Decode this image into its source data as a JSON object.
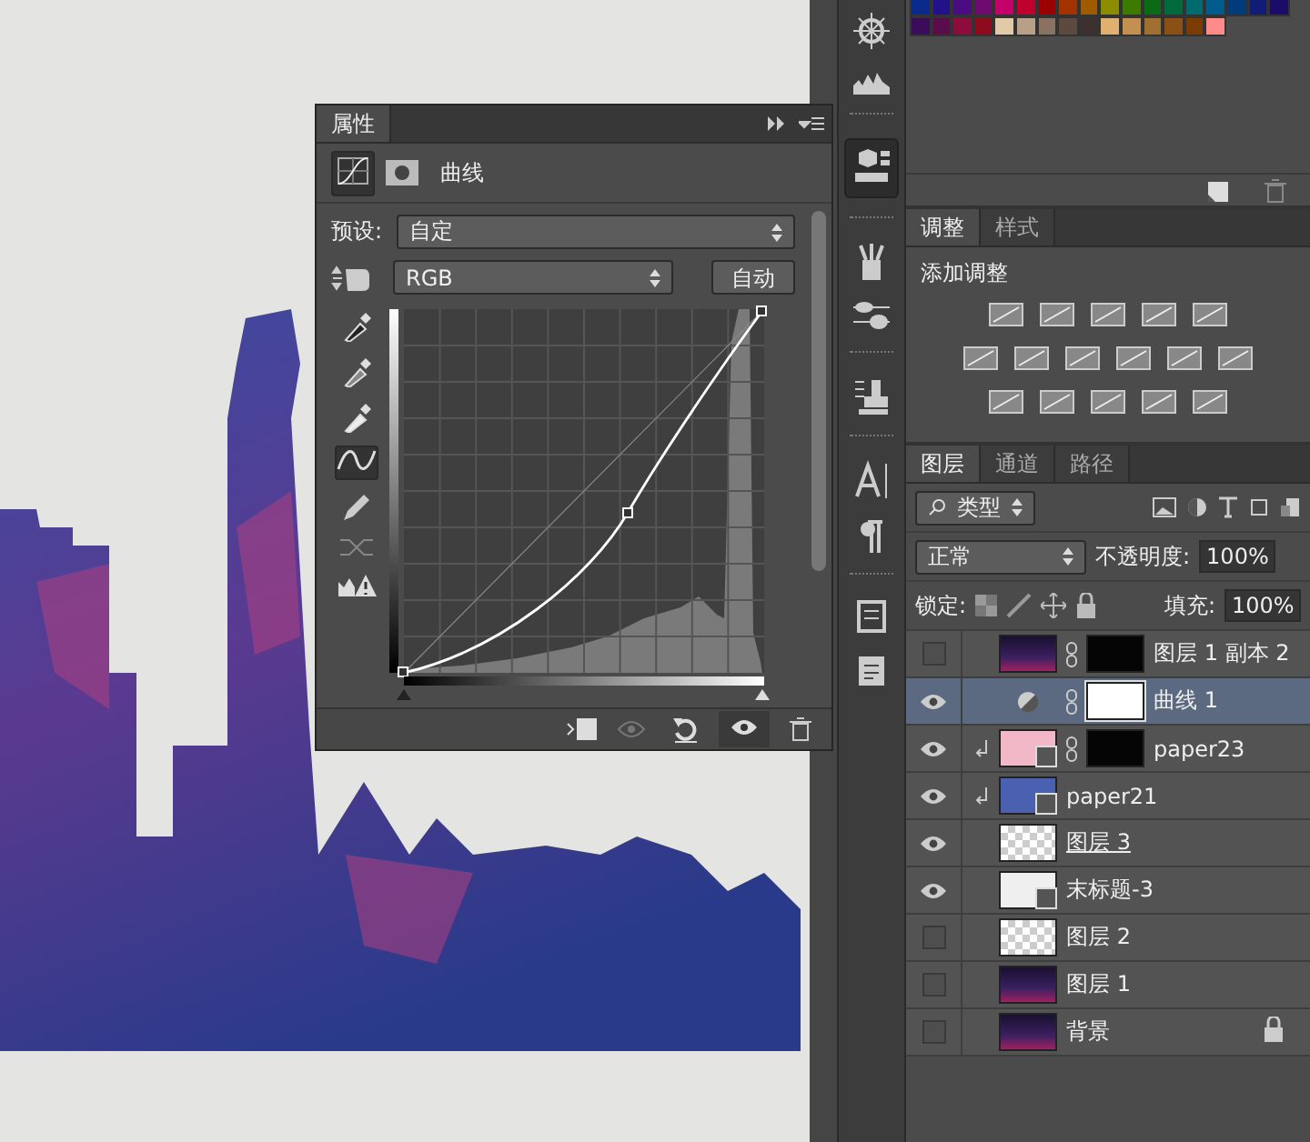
{
  "properties_panel": {
    "tab": "属性",
    "title": "曲线",
    "preset_label": "预设:",
    "preset": "自定",
    "channel": "RGB",
    "auto_button": "自动",
    "input_sliders": [
      {
        "level": 0
      },
      {
        "level": 1
      }
    ]
  },
  "swatches": [
    {
      "color": "#0c2a8c"
    },
    {
      "color": "#22128a"
    },
    {
      "color": "#4a0c80"
    },
    {
      "color": "#6e0a70"
    },
    {
      "color": "#c4006a"
    },
    {
      "color": "#c0002e"
    },
    {
      "color": "#9c0000"
    },
    {
      "color": "#a23200"
    },
    {
      "color": "#a05a00"
    },
    {
      "color": "#8c8c00"
    },
    {
      "color": "#3c7a00"
    },
    {
      "color": "#0a6a16"
    },
    {
      "color": "#006a3c"
    },
    {
      "color": "#006a6e"
    },
    {
      "color": "#005c8c"
    },
    {
      "color": "#003c7c"
    },
    {
      "color": "#101c78"
    },
    {
      "color": "#1c0c6a"
    },
    {
      "color": "#3a0c5a"
    },
    {
      "color": "#5a0c4c"
    },
    {
      "color": "#8c0c3c"
    },
    {
      "color": "#8c0a1c"
    },
    {
      "color": "#e0caa8"
    },
    {
      "color": "#b8a088"
    },
    {
      "color": "#8a7262"
    },
    {
      "color": "#5c4a40"
    },
    {
      "color": "#3c3030"
    },
    {
      "color": "#e0b070"
    },
    {
      "color": "#c49050"
    },
    {
      "color": "#a07030"
    },
    {
      "color": "#8a5014"
    },
    {
      "color": "#7a3c00"
    },
    {
      "color": "#ff8a8a"
    }
  ],
  "adjustments_panel": {
    "tabs": [
      {
        "label": "调整",
        "selected": true
      },
      {
        "label": "样式",
        "selected": false
      }
    ],
    "heading": "添加调整"
  },
  "layers_panel": {
    "tabs": [
      {
        "label": "图层",
        "selected": true
      },
      {
        "label": "通道",
        "selected": false
      },
      {
        "label": "路径",
        "selected": false
      }
    ],
    "filter": "类型",
    "blend_mode": "正常",
    "opacity_label": "不透明度:",
    "opacity": "100%",
    "lock_label": "锁定:",
    "fill_label": "填充:",
    "fill": "100%",
    "layers": [
      {
        "name": "图层 1 副本 2",
        "visible": false,
        "selected": false,
        "clipped": false,
        "smart": false,
        "underlined": false,
        "locked": false,
        "thumb": {
          "kind": "photo"
        },
        "mask": {
          "kind": "dark"
        }
      },
      {
        "name": "曲线 1",
        "visible": true,
        "selected": true,
        "clipped": false,
        "smart": false,
        "underlined": false,
        "locked": false,
        "thumb": {
          "kind": "adjustment"
        },
        "mask": {
          "kind": "white"
        }
      },
      {
        "name": "paper23",
        "visible": true,
        "selected": false,
        "clipped": true,
        "smart": true,
        "underlined": false,
        "locked": false,
        "thumb": {
          "kind": "pink"
        },
        "mask": {
          "kind": "dark"
        }
      },
      {
        "name": "paper21",
        "visible": true,
        "selected": false,
        "clipped": true,
        "smart": true,
        "underlined": false,
        "locked": false,
        "thumb": {
          "kind": "blue"
        }
      },
      {
        "name": "图层 3",
        "visible": true,
        "selected": false,
        "clipped": false,
        "smart": false,
        "underlined": true,
        "locked": false,
        "thumb": {
          "kind": "transparent"
        }
      },
      {
        "name": "末标题-3",
        "visible": true,
        "selected": false,
        "clipped": false,
        "smart": true,
        "underlined": false,
        "locked": false,
        "thumb": {
          "kind": "white"
        }
      },
      {
        "name": "图层 2",
        "visible": false,
        "selected": false,
        "clipped": false,
        "smart": false,
        "underlined": false,
        "locked": false,
        "thumb": {
          "kind": "transparent"
        }
      },
      {
        "name": "图层 1",
        "visible": false,
        "selected": false,
        "clipped": false,
        "smart": false,
        "underlined": false,
        "locked": false,
        "thumb": {
          "kind": "photo"
        }
      },
      {
        "name": "背景",
        "visible": false,
        "selected": false,
        "clipped": false,
        "smart": false,
        "underlined": false,
        "locked": true,
        "thumb": {
          "kind": "photo"
        }
      }
    ]
  }
}
